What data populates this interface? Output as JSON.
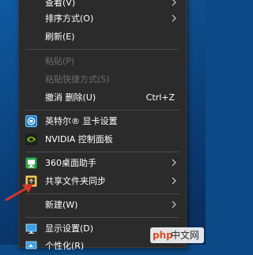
{
  "menu": {
    "items": [
      {
        "label": "查看(V)",
        "has_submenu": true,
        "disabled": false
      },
      {
        "label": "排序方式(O)",
        "has_submenu": true,
        "disabled": false
      },
      {
        "label": "刷新(E)",
        "has_submenu": false,
        "disabled": false
      },
      {
        "label": "粘贴(P)",
        "has_submenu": false,
        "disabled": true
      },
      {
        "label": "粘贴快捷方式(S)",
        "has_submenu": false,
        "disabled": true
      },
      {
        "label": "撤消 删除(U)",
        "shortcut": "Ctrl+Z",
        "has_submenu": false,
        "disabled": false
      },
      {
        "label": "英特尔® 显卡设置",
        "icon": "intel-graphics-icon",
        "has_submenu": false,
        "disabled": false
      },
      {
        "label": "NVIDIA 控制面板",
        "icon": "nvidia-icon",
        "has_submenu": false,
        "disabled": false
      },
      {
        "label": "360桌面助手",
        "icon": "360-desktop-icon",
        "has_submenu": true,
        "disabled": false
      },
      {
        "label": "共享文件夹同步",
        "icon": "folder-sync-icon",
        "has_submenu": true,
        "disabled": false
      },
      {
        "label": "新建(W)",
        "has_submenu": true,
        "disabled": false
      },
      {
        "label": "显示设置(D)",
        "icon": "display-settings-icon",
        "has_submenu": false,
        "disabled": false
      },
      {
        "label": "个性化(R)",
        "icon": "personalize-icon",
        "has_submenu": false,
        "disabled": false
      }
    ]
  },
  "watermark": {
    "logo": "php",
    "text": "中文网"
  },
  "colors": {
    "menu_bg": "#2b2b2b",
    "disabled_text": "#6d6d6d",
    "annotation_arrow": "#d9342b",
    "desktop_bg": "#0b4a86"
  }
}
